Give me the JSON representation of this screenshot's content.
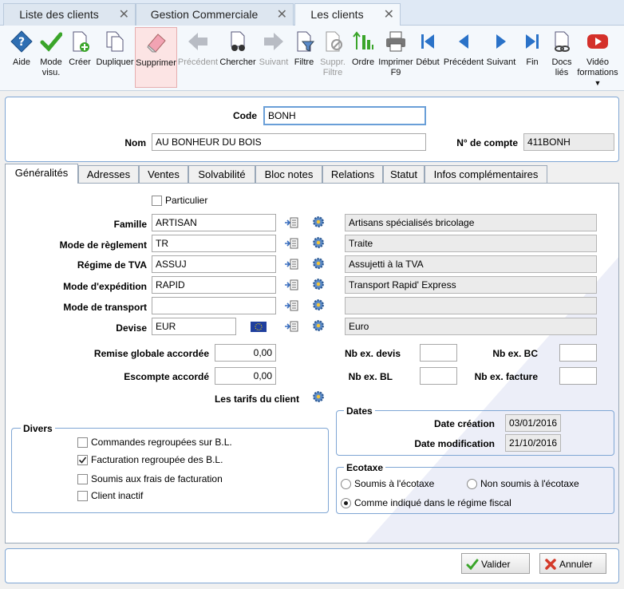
{
  "window_tabs": [
    {
      "label": "Liste des clients"
    },
    {
      "label": "Gestion Commerciale"
    },
    {
      "label": "Les clients"
    }
  ],
  "toolbar": {
    "aide": "Aide",
    "mode_visu_1": "Mode",
    "mode_visu_2": "visu.",
    "creer": "Créer",
    "dupliquer": "Dupliquer",
    "supprimer": "Supprimer",
    "precedent_dis": "Précédent",
    "chercher": "Chercher",
    "suivant_dis": "Suivant",
    "filtre": "Filtre",
    "suppr_filtre_1": "Suppr.",
    "suppr_filtre_2": "Filtre",
    "ordre": "Ordre",
    "imprimer_1": "Imprimer",
    "imprimer_2": "F9",
    "debut": "Début",
    "precedent": "Précédent",
    "suivant": "Suivant",
    "fin": "Fin",
    "docs_1": "Docs",
    "docs_2": "liés",
    "video_1": "Vidéo",
    "video_2": "formations"
  },
  "header": {
    "code_label": "Code",
    "code_value": "BONH",
    "nom_label": "Nom",
    "nom_value": "AU BONHEUR DU BOIS",
    "compte_label": "N° de compte",
    "compte_value": "411BONH"
  },
  "form_tabs": [
    {
      "label": "Généralités"
    },
    {
      "label": "Adresses"
    },
    {
      "label": "Ventes"
    },
    {
      "label": "Solvabilité"
    },
    {
      "label": "Bloc notes"
    },
    {
      "label": "Relations"
    },
    {
      "label": "Statut"
    },
    {
      "label": "Infos complémentaires"
    }
  ],
  "general": {
    "particulier": "Particulier",
    "famille_label": "Famille",
    "famille_value": "ARTISAN",
    "famille_desc": "Artisans spécialisés bricolage",
    "reglement_label": "Mode de règlement",
    "reglement_value": "TR",
    "reglement_desc": "Traite",
    "tva_label": "Régime de TVA",
    "tva_value": "ASSUJ",
    "tva_desc": "Assujetti à la TVA",
    "expedition_label": "Mode d'expédition",
    "expedition_value": "RAPID",
    "expedition_desc": "Transport Rapid' Express",
    "transport_label": "Mode de transport",
    "transport_value": "",
    "transport_desc": "",
    "devise_label": "Devise",
    "devise_value": "EUR",
    "devise_desc": "Euro",
    "remise_label": "Remise globale accordée",
    "remise_value": "0,00",
    "escompte_label": "Escompte accordé",
    "escompte_value": "0,00",
    "tarifs_label": "Les tarifs du client",
    "nb_devis_label": "Nb ex. devis",
    "nb_devis_value": "",
    "nb_bc_label": "Nb ex. BC",
    "nb_bc_value": "",
    "nb_bl_label": "Nb ex. BL",
    "nb_bl_value": "",
    "nb_facture_label": "Nb ex. facture",
    "nb_facture_value": ""
  },
  "divers": {
    "title": "Divers",
    "items": [
      {
        "label": "Commandes regroupées sur B.L.",
        "checked": false
      },
      {
        "label": "Facturation regroupée des B.L.",
        "checked": true
      },
      {
        "label": "Soumis aux frais de facturation",
        "checked": false
      },
      {
        "label": "Client inactif",
        "checked": false
      }
    ]
  },
  "dates": {
    "title": "Dates",
    "creation_label": "Date création",
    "creation_value": "03/01/2016",
    "modification_label": "Date modification",
    "modification_value": "21/10/2016"
  },
  "ecotaxe": {
    "title": "Ecotaxe",
    "soumis": "Soumis à l'écotaxe",
    "non_soumis": "Non soumis à l'écotaxe",
    "comme": "Comme indiqué dans le régime fiscal"
  },
  "footer": {
    "valider": "Valider",
    "annuler": "Annuler"
  },
  "colors": {
    "accent_border": "#7fa6d4",
    "selected_tool": "#fce4e4",
    "nav_blue": "#2a72c8"
  }
}
